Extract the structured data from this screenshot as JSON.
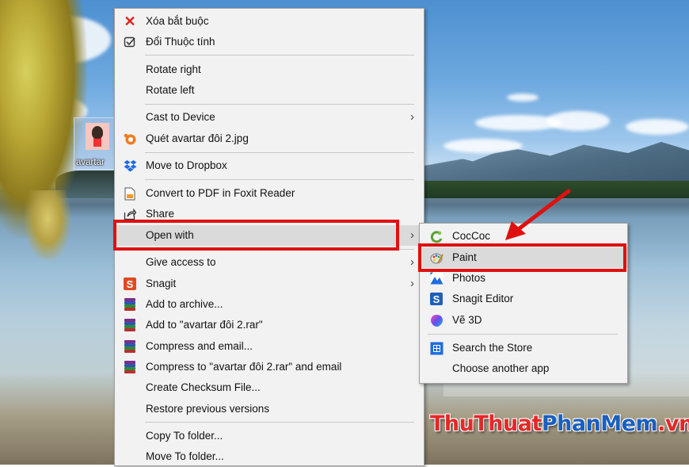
{
  "desktop": {
    "icon_label": "avartar"
  },
  "context_menu": {
    "items": [
      {
        "label": "Xóa bắt buộc",
        "icon": "red-x-icon"
      },
      {
        "label": "Đổi Thuộc tính",
        "icon": "check-list-icon"
      },
      {
        "label": "Rotate right"
      },
      {
        "label": "Rotate left"
      },
      {
        "label": "Cast to Device",
        "has_submenu": true
      },
      {
        "label": "Quét avartar đôi 2.jpg",
        "icon": "avast-icon"
      },
      {
        "label": "Move to Dropbox",
        "icon": "dropbox-icon"
      },
      {
        "label": "Convert to PDF in Foxit Reader",
        "icon": "foxit-icon"
      },
      {
        "label": "Share",
        "icon": "share-icon"
      },
      {
        "label": "Open with",
        "has_submenu": true,
        "highlighted": true
      },
      {
        "label": "Give access to",
        "has_submenu": true
      },
      {
        "label": "Snagit",
        "icon": "snagit-icon",
        "has_submenu": true
      },
      {
        "label": "Add to archive...",
        "icon": "winrar-icon"
      },
      {
        "label": "Add to \"avartar đôi 2.rar\"",
        "icon": "winrar-icon"
      },
      {
        "label": "Compress and email...",
        "icon": "winrar-icon"
      },
      {
        "label": "Compress to \"avartar đôi 2.rar\" and email",
        "icon": "winrar-icon"
      },
      {
        "label": "Create Checksum File..."
      },
      {
        "label": "Restore previous versions"
      },
      {
        "label": "Copy To folder..."
      },
      {
        "label": "Move To folder..."
      }
    ],
    "submenu_arrow": "›"
  },
  "open_with_submenu": {
    "items": [
      {
        "label": "CocCoc",
        "icon": "coccoc-icon"
      },
      {
        "label": "Paint",
        "icon": "paint-icon",
        "highlighted": true
      },
      {
        "label": "Photos",
        "icon": "photos-icon"
      },
      {
        "label": "Snagit Editor",
        "icon": "snagit-editor-icon"
      },
      {
        "label": "Vẽ 3D",
        "icon": "paint-3d-icon"
      },
      {
        "label": "Search the Store",
        "icon": "store-icon"
      },
      {
        "label": "Choose another app"
      }
    ]
  },
  "watermark": {
    "part1": "ThuThuat",
    "part2": "PhanMem",
    "part3": ".vn"
  },
  "colors": {
    "annotation_red": "#e01010",
    "menu_bg": "#f2f2f2",
    "highlight": "#dadada"
  }
}
